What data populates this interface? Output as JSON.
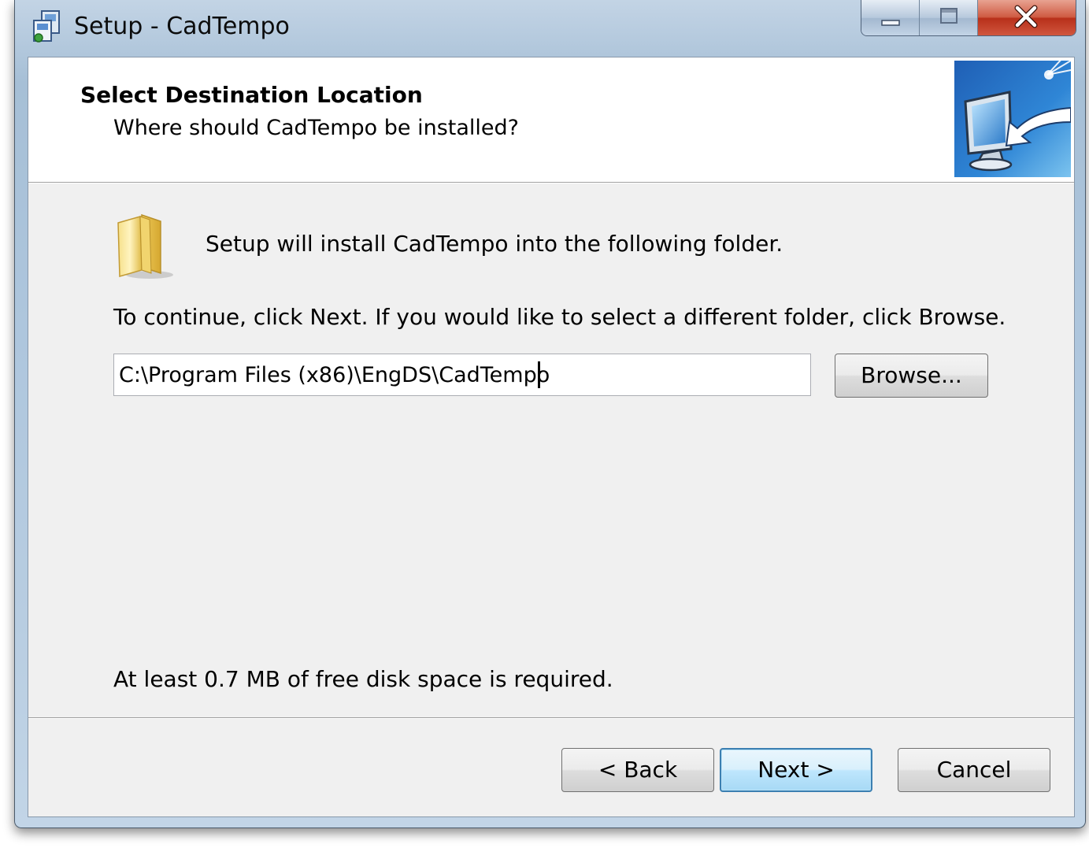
{
  "window": {
    "title": "Setup - CadTempo",
    "caption_buttons": [
      "minimize-icon",
      "maximize-icon",
      "close-icon"
    ]
  },
  "header": {
    "title": "Select Destination Location",
    "subtitle": "Where should CadTempo be installed?",
    "image_icon": "monitor-arrow-icon"
  },
  "body": {
    "folder_icon": "folder-icon",
    "intro": "Setup will install CadTempo into the following folder.",
    "instructions": "To continue, click Next. If you would like to select a different folder, click Browse.",
    "path_value": "C:\\Program Files (x86)\\EngDS\\CadTempo",
    "browse_label": "Browse...",
    "disk_space": "At least 0.7 MB of free disk space is required."
  },
  "footer": {
    "back_label": "< Back",
    "next_label": "Next >",
    "cancel_label": "Cancel"
  },
  "colors": {
    "title_bar": "#aec6dd",
    "close_button": "#c43b22",
    "default_button_border": "#3c7fb1",
    "client_background": "#f0f0f0"
  }
}
